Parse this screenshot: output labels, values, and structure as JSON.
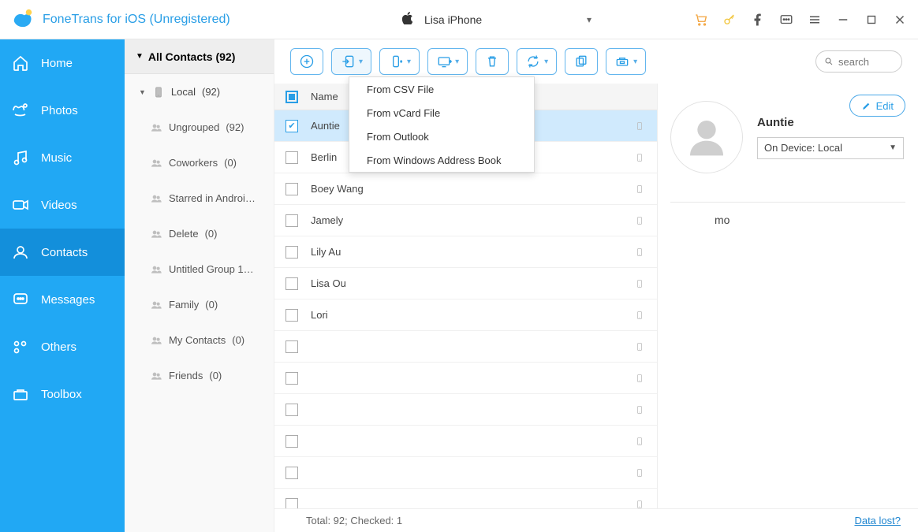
{
  "app_title": "FoneTrans for iOS (Unregistered)",
  "device_name": "Lisa iPhone",
  "sidebar": [
    {
      "icon": "home",
      "label": "Home"
    },
    {
      "icon": "photos",
      "label": "Photos"
    },
    {
      "icon": "music",
      "label": "Music"
    },
    {
      "icon": "videos",
      "label": "Videos"
    },
    {
      "icon": "contacts",
      "label": "Contacts"
    },
    {
      "icon": "messages",
      "label": "Messages"
    },
    {
      "icon": "others",
      "label": "Others"
    },
    {
      "icon": "toolbox",
      "label": "Toolbox"
    }
  ],
  "active_sidebar": "Contacts",
  "groups_head": "All Contacts  (92)",
  "device_group": {
    "label": "Local",
    "count": "(92)"
  },
  "groups": [
    {
      "label": "Ungrouped",
      "count": "(92)"
    },
    {
      "label": "Coworkers",
      "count": "(0)"
    },
    {
      "label": "Starred in Androi…",
      "count": ""
    },
    {
      "label": "Delete",
      "count": "(0)"
    },
    {
      "label": "Untitled Group 1…",
      "count": ""
    },
    {
      "label": "Family",
      "count": "(0)"
    },
    {
      "label": "My Contacts",
      "count": "(0)"
    },
    {
      "label": "Friends",
      "count": "(0)"
    }
  ],
  "list_header": "Name",
  "dropdown_items": [
    "From CSV File",
    "From vCard File",
    "From Outlook",
    "From Windows Address Book"
  ],
  "contacts": [
    {
      "name": "Auntie",
      "checked": true,
      "selected": true
    },
    {
      "name": "Berlin",
      "checked": false,
      "selected": false
    },
    {
      "name": "Boey Wang",
      "checked": false,
      "selected": false
    },
    {
      "name": "Jamely",
      "checked": false,
      "selected": false
    },
    {
      "name": "Lily Au",
      "checked": false,
      "selected": false
    },
    {
      "name": "Lisa Ou",
      "checked": false,
      "selected": false
    },
    {
      "name": "Lori",
      "checked": false,
      "selected": false
    },
    {
      "name": "",
      "checked": false,
      "selected": false
    },
    {
      "name": "",
      "checked": false,
      "selected": false
    },
    {
      "name": "",
      "checked": false,
      "selected": false
    },
    {
      "name": "",
      "checked": false,
      "selected": false
    },
    {
      "name": "",
      "checked": false,
      "selected": false
    },
    {
      "name": "",
      "checked": false,
      "selected": false
    }
  ],
  "status_total": "Total: 92; Checked: 1",
  "data_lost": "Data lost?",
  "search_placeholder": "search",
  "edit_label": "Edit",
  "detail_name": "Auntie",
  "on_device": "On Device: Local",
  "detail_field": "mo"
}
